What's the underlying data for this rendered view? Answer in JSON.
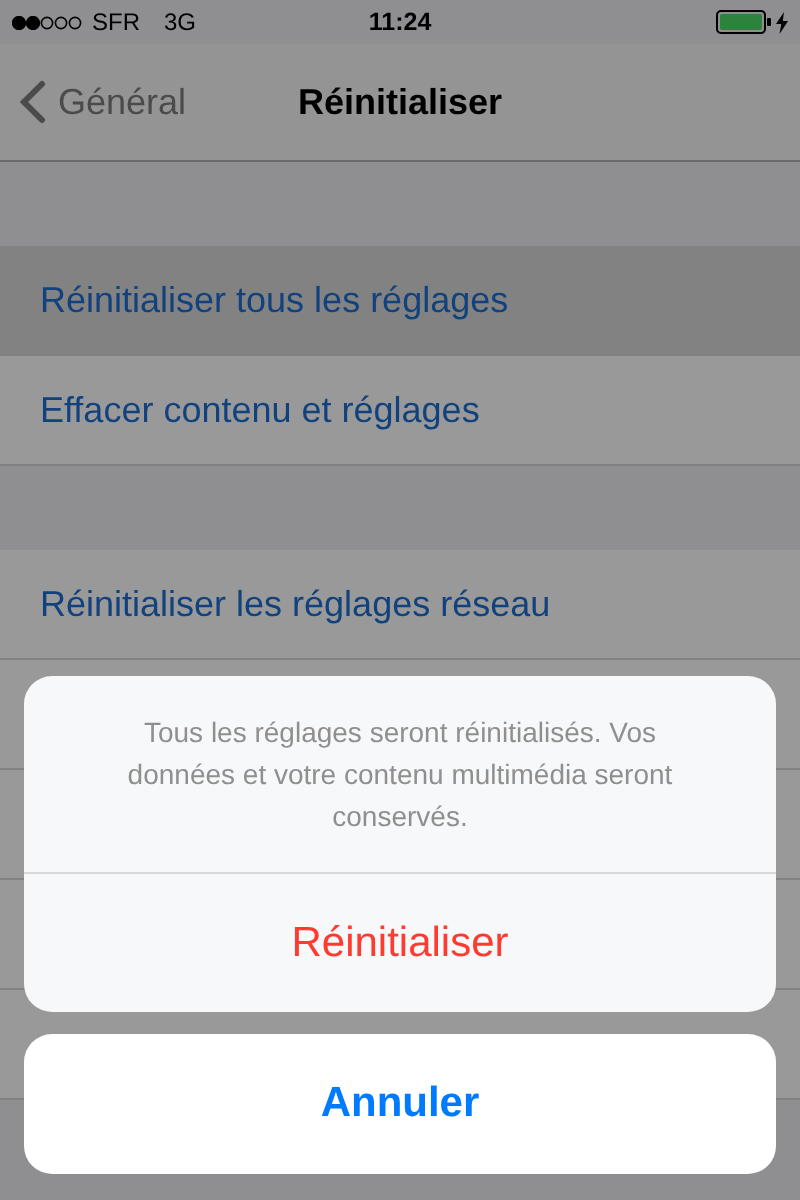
{
  "status_bar": {
    "carrier": "SFR",
    "network": "3G",
    "time": "11:24"
  },
  "nav": {
    "back": "Général",
    "title": "Réinitialiser"
  },
  "sections": [
    {
      "rows": [
        {
          "label": "Réinitialiser tous les réglages",
          "selected": true
        },
        {
          "label": "Effacer contenu et réglages",
          "selected": false
        }
      ]
    },
    {
      "rows": [
        {
          "label": "Réinitialiser les réglages réseau",
          "selected": false
        }
      ]
    }
  ],
  "action_sheet": {
    "message": "Tous les réglages seront réinitialisés. Vos données et votre contenu multimédia seront conservés.",
    "actions": [
      {
        "label": "Réinitialiser",
        "kind": "destructive"
      }
    ],
    "cancel": "Annuler"
  }
}
